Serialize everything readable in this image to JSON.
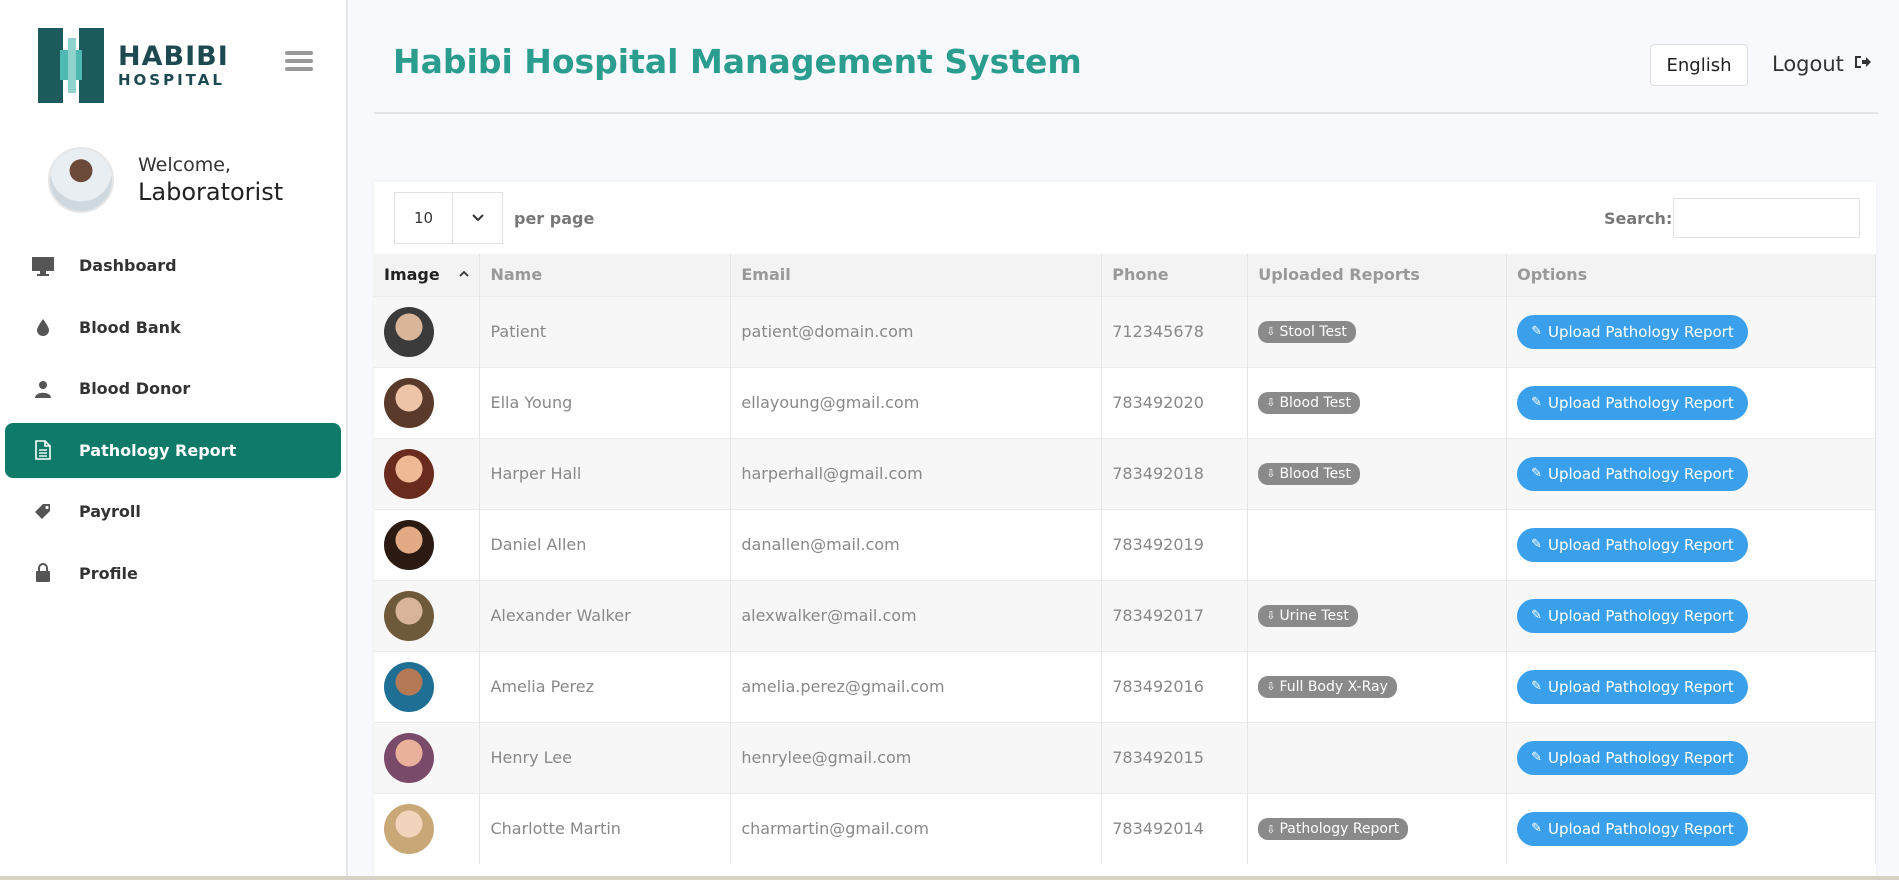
{
  "logo": {
    "line1": "HABIBI",
    "line2": "HOSPITAL"
  },
  "user": {
    "welcome": "Welcome,",
    "role": "Laboratorist"
  },
  "nav": [
    {
      "label": "Dashboard",
      "icon": "monitor-icon",
      "active": false
    },
    {
      "label": "Blood Bank",
      "icon": "drop-icon",
      "active": false
    },
    {
      "label": "Blood Donor",
      "icon": "user-icon",
      "active": false
    },
    {
      "label": "Pathology Report",
      "icon": "document-icon",
      "active": true
    },
    {
      "label": "Payroll",
      "icon": "tag-icon",
      "active": false
    },
    {
      "label": "Profile",
      "icon": "lock-icon",
      "active": false
    }
  ],
  "header": {
    "title": "Habibi Hospital Management System",
    "language": "English",
    "logout": "Logout"
  },
  "table_controls": {
    "per_page_value": "10",
    "per_page_label": "per page",
    "search_label": "Search:",
    "search_value": ""
  },
  "columns": [
    "Image",
    "Name",
    "Email",
    "Phone",
    "Uploaded Reports",
    "Options"
  ],
  "rows": [
    {
      "name": "Patient",
      "email": "patient@domain.com",
      "phone": "712345678",
      "report": "Stool Test",
      "action": "Upload Pathology Report"
    },
    {
      "name": "Ella Young",
      "email": "ellayoung@gmail.com",
      "phone": "783492020",
      "report": "Blood Test",
      "action": "Upload Pathology Report"
    },
    {
      "name": "Harper Hall",
      "email": "harperhall@gmail.com",
      "phone": "783492018",
      "report": "Blood Test",
      "action": "Upload Pathology Report"
    },
    {
      "name": "Daniel Allen",
      "email": "danallen@mail.com",
      "phone": "783492019",
      "report": "",
      "action": "Upload Pathology Report"
    },
    {
      "name": "Alexander Walker",
      "email": "alexwalker@mail.com",
      "phone": "783492017",
      "report": "Urine Test",
      "action": "Upload Pathology Report"
    },
    {
      "name": "Amelia Perez",
      "email": "amelia.perez@gmail.com",
      "phone": "783492016",
      "report": "Full Body X-Ray",
      "action": "Upload Pathology Report"
    },
    {
      "name": "Henry Lee",
      "email": "henrylee@gmail.com",
      "phone": "783492015",
      "report": "",
      "action": "Upload Pathology Report"
    },
    {
      "name": "Charlotte Martin",
      "email": "charmartin@gmail.com",
      "phone": "783492014",
      "report": "Pathology Report",
      "action": "Upload Pathology Report"
    }
  ],
  "colors": {
    "accent": "#0f7a68",
    "title": "#2a9d8f",
    "button": "#3aa0ec",
    "badge": "#8a8a8a"
  }
}
